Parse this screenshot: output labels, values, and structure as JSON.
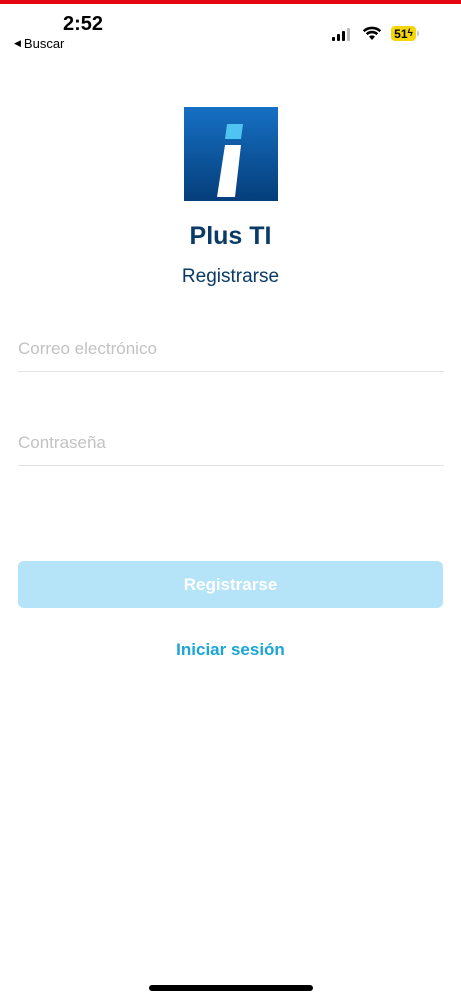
{
  "status_bar": {
    "time": "2:52",
    "back_label": "Buscar",
    "battery_level": "51",
    "icons": [
      "cellular-signal-icon",
      "wifi-icon",
      "battery-charging-icon",
      "back-arrow-icon"
    ]
  },
  "app": {
    "name": "Plus TI",
    "logo_icon": "app-logo-i-icon",
    "screen_title": "Registrarse"
  },
  "form": {
    "email_placeholder": "Correo electrónico",
    "email_value": "",
    "password_placeholder": "Contraseña",
    "password_value": "",
    "submit_label": "Registrarse",
    "submit_enabled": false,
    "login_link_label": "Iniciar sesión"
  },
  "colors": {
    "top_accent": "#e30613",
    "brand_dark_blue": "#0a3a66",
    "logo_blue": "#0a5fae",
    "link_cyan": "#1aa6d6",
    "button_disabled_bg": "#b5e3f7",
    "battery_bg": "#f5d60a"
  }
}
